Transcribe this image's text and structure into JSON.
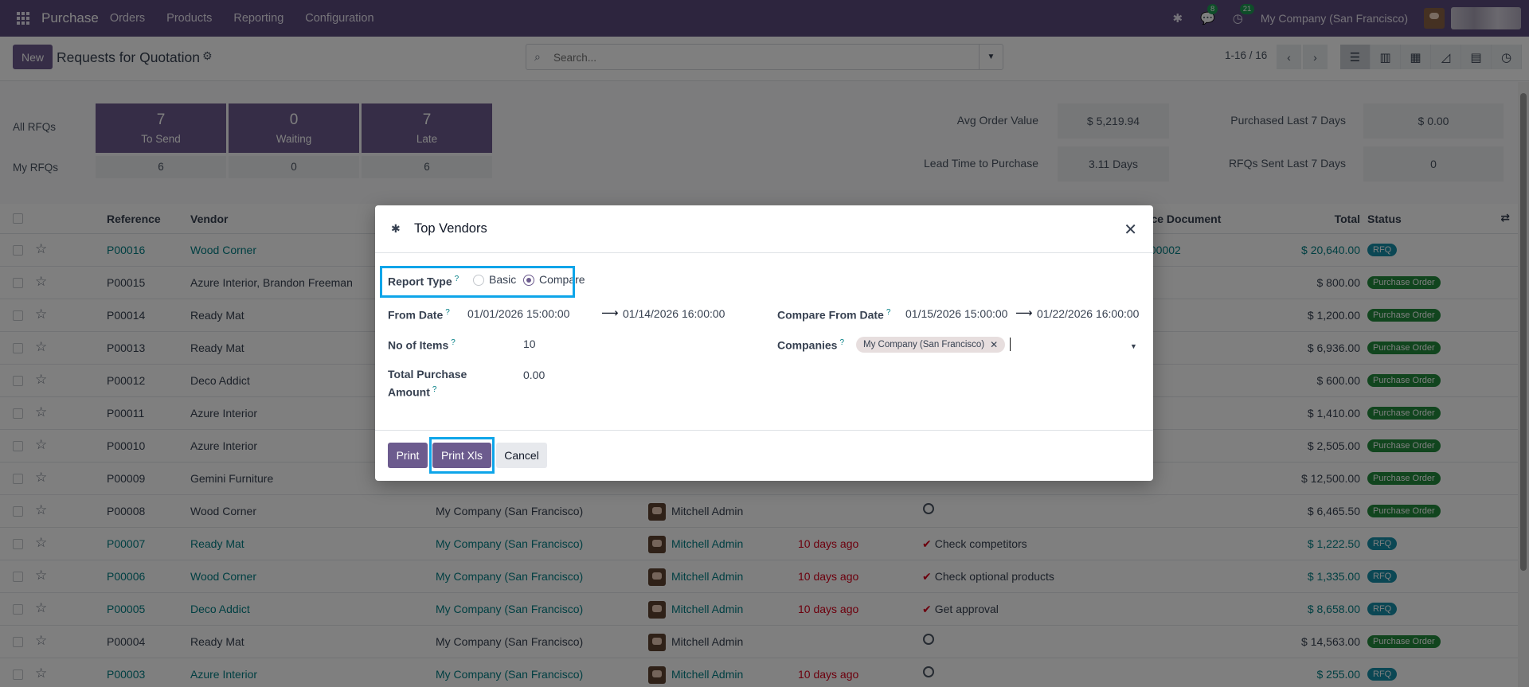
{
  "navbar": {
    "app_name": "Purchase",
    "menus": [
      "Orders",
      "Products",
      "Reporting",
      "Configuration"
    ],
    "messages_count": "8",
    "activities_count": "21",
    "company": "My Company (San Francisco)"
  },
  "control": {
    "new_label": "New",
    "title": "Requests for Quotation",
    "search_placeholder": "Search...",
    "pager": "1-16 / 16"
  },
  "dashboard": {
    "all_rfqs_label": "All RFQs",
    "my_rfqs_label": "My RFQs",
    "tiles": [
      {
        "value": "7",
        "label": "To Send",
        "mine": "6"
      },
      {
        "value": "0",
        "label": "Waiting",
        "mine": "0"
      },
      {
        "value": "7",
        "label": "Late",
        "mine": "6"
      }
    ],
    "kpis": {
      "avg_order_label": "Avg Order Value",
      "avg_order_value": "$ 5,219.94",
      "purchased_label": "Purchased Last 7 Days",
      "purchased_value": "$ 0.00",
      "lead_time_label": "Lead Time to Purchase",
      "lead_time_value": "3.11 Days",
      "rfqs_sent_label": "RFQs Sent Last 7 Days",
      "rfqs_sent_value": "0"
    }
  },
  "list": {
    "headers": {
      "reference": "Reference",
      "vendor": "Vendor",
      "source": "rce Document",
      "total": "Total",
      "status": "Status"
    },
    "rows": [
      {
        "ref": "P00016",
        "vendor": "Wood Corner",
        "company": "",
        "buyer": "",
        "deadline": "",
        "activity": "",
        "source": "/00002",
        "total": "$ 20,640.00",
        "status": "RFQ"
      },
      {
        "ref": "P00015",
        "vendor": "Azure Interior, Brandon Freeman",
        "company": "",
        "buyer": "",
        "deadline": "",
        "activity": "",
        "source": "",
        "total": "$ 800.00",
        "status": "Purchase Order"
      },
      {
        "ref": "P00014",
        "vendor": "Ready Mat",
        "company": "",
        "buyer": "",
        "deadline": "",
        "activity": "",
        "source": "",
        "total": "$ 1,200.00",
        "status": "Purchase Order"
      },
      {
        "ref": "P00013",
        "vendor": "Ready Mat",
        "company": "",
        "buyer": "",
        "deadline": "",
        "activity": "",
        "source": "",
        "total": "$ 6,936.00",
        "status": "Purchase Order"
      },
      {
        "ref": "P00012",
        "vendor": "Deco Addict",
        "company": "",
        "buyer": "",
        "deadline": "",
        "activity": "",
        "source": "",
        "total": "$ 600.00",
        "status": "Purchase Order"
      },
      {
        "ref": "P00011",
        "vendor": "Azure Interior",
        "company": "",
        "buyer": "",
        "deadline": "",
        "activity": "",
        "source": "",
        "total": "$ 1,410.00",
        "status": "Purchase Order"
      },
      {
        "ref": "P00010",
        "vendor": "Azure Interior",
        "company": "",
        "buyer": "",
        "deadline": "",
        "activity": "",
        "source": "",
        "total": "$ 2,505.00",
        "status": "Purchase Order"
      },
      {
        "ref": "P00009",
        "vendor": "Gemini Furniture",
        "company": "",
        "buyer": "",
        "deadline": "",
        "activity": "",
        "source": "",
        "total": "$ 12,500.00",
        "status": "Purchase Order"
      },
      {
        "ref": "P00008",
        "vendor": "Wood Corner",
        "company": "My Company (San Francisco)",
        "buyer": "Mitchell Admin",
        "deadline": "",
        "activity": "",
        "source": "",
        "total": "$ 6,465.50",
        "status": "Purchase Order"
      },
      {
        "ref": "P00007",
        "vendor": "Ready Mat",
        "company": "My Company (San Francisco)",
        "buyer": "Mitchell Admin",
        "deadline": "10 days ago",
        "activity": "Check competitors",
        "source": "",
        "total": "$ 1,222.50",
        "status": "RFQ"
      },
      {
        "ref": "P00006",
        "vendor": "Wood Corner",
        "company": "My Company (San Francisco)",
        "buyer": "Mitchell Admin",
        "deadline": "10 days ago",
        "activity": "Check optional products",
        "source": "",
        "total": "$ 1,335.00",
        "status": "RFQ"
      },
      {
        "ref": "P00005",
        "vendor": "Deco Addict",
        "company": "My Company (San Francisco)",
        "buyer": "Mitchell Admin",
        "deadline": "10 days ago",
        "activity": "Get approval",
        "source": "",
        "total": "$ 8,658.00",
        "status": "RFQ"
      },
      {
        "ref": "P00004",
        "vendor": "Ready Mat",
        "company": "My Company (San Francisco)",
        "buyer": "Mitchell Admin",
        "deadline": "",
        "activity": "",
        "source": "",
        "total": "$ 14,563.00",
        "status": "Purchase Order"
      },
      {
        "ref": "P00003",
        "vendor": "Azure Interior",
        "company": "My Company (San Francisco)",
        "buyer": "Mitchell Admin",
        "deadline": "10 days ago",
        "activity": "",
        "source": "",
        "total": "$ 255.00",
        "status": "RFQ"
      }
    ]
  },
  "modal": {
    "title": "Top Vendors",
    "report_type_label": "Report Type",
    "option_basic": "Basic",
    "option_compare": "Compare",
    "selected_option": "Compare",
    "from_date_label": "From Date",
    "from_date_start": "01/01/2026 15:00:00",
    "from_date_end": "01/14/2026 16:00:00",
    "compare_label": "Compare From Date",
    "compare_start": "01/15/2026 15:00:00",
    "compare_end": "01/22/2026 16:00:00",
    "items_label": "No of Items",
    "items_value": "10",
    "companies_label": "Companies",
    "company_tag": "My Company (San Francisco)",
    "amount_label_1": "Total Purchase",
    "amount_label_2": "Amount",
    "amount_value": "0.00",
    "help_mark": "?",
    "print_label": "Print",
    "print_xls_label": "Print Xls",
    "cancel_label": "Cancel"
  },
  "colors": {
    "navbar": "#5b4b7c",
    "primary": "#6c5b8e",
    "link": "#017e84",
    "highlight": "#0ea5e9",
    "rfq_badge": "#178fa8",
    "po_badge": "#228b3d"
  }
}
